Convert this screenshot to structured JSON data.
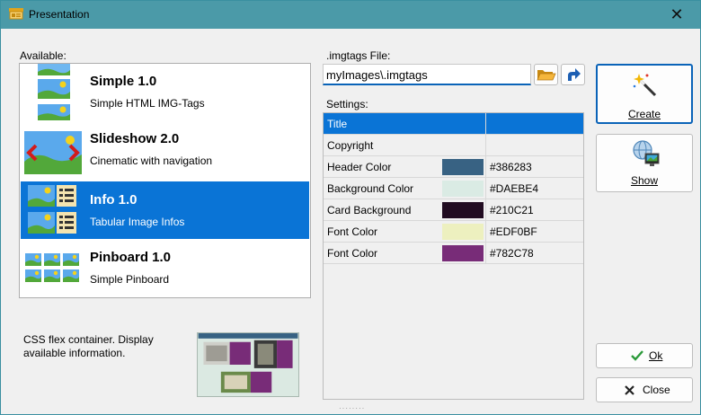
{
  "window": {
    "title": "Presentation"
  },
  "available": {
    "label": "Available:",
    "items": [
      {
        "name": "Simple 1.0",
        "description": "Simple HTML IMG-Tags",
        "selected": false
      },
      {
        "name": "Slideshow 2.0",
        "description": "Cinematic with navigation",
        "selected": false
      },
      {
        "name": "Info 1.0",
        "description": "Tabular Image Infos",
        "selected": true
      },
      {
        "name": "Pinboard 1.0",
        "description": "Simple Pinboard",
        "selected": false
      }
    ],
    "details": "CSS flex container. Display available information."
  },
  "imgtags": {
    "label": ".imgtags File:",
    "value": "myImages\\.imgtags"
  },
  "settings": {
    "label": "Settings:",
    "rows": [
      {
        "name": "Title",
        "value": "",
        "color": "",
        "selected": true
      },
      {
        "name": "Copyright",
        "value": "",
        "color": "",
        "selected": false
      },
      {
        "name": "Header Color",
        "value": "#386283",
        "color": "#386283",
        "selected": false
      },
      {
        "name": "Background Color",
        "value": "#DAEBE4",
        "color": "#DAEBE4",
        "selected": false
      },
      {
        "name": "Card Background",
        "value": "#210C21",
        "color": "#210C21",
        "selected": false
      },
      {
        "name": "Font Color",
        "value": "#EDF0BF",
        "color": "#EDF0BF",
        "selected": false
      },
      {
        "name": "Font Color",
        "value": "#782C78",
        "color": "#782C78",
        "selected": false
      }
    ]
  },
  "buttons": {
    "create": "Create",
    "show": "Show",
    "ok": "Ok",
    "close": "Close"
  },
  "icons": {
    "app": "presentation-icon",
    "close": "close-icon",
    "open_folder": "folder-open-icon",
    "go": "arrow-redirect-icon",
    "create": "magic-wand-icon",
    "show": "globe-monitor-icon",
    "ok": "checkmark-icon",
    "close_btn": "x-icon"
  },
  "colors": {
    "accent": "#0A74D6",
    "titlebar": "#4B9AA8"
  }
}
